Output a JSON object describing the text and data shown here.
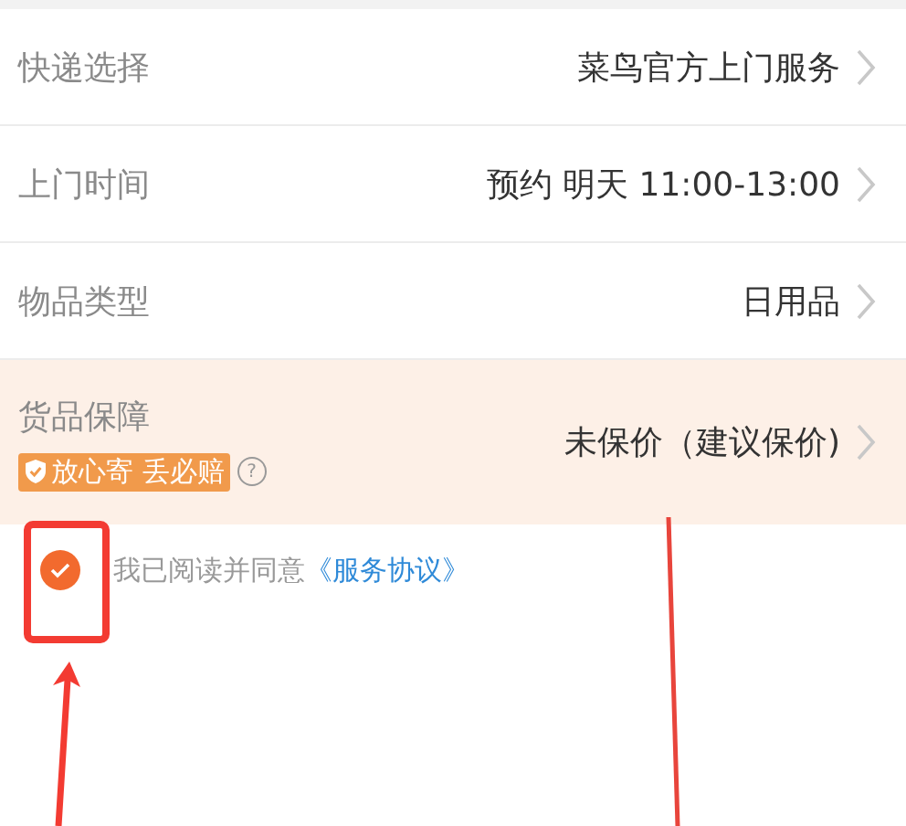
{
  "rows": [
    {
      "kind": "plain",
      "label": "快递选择",
      "value": "菜鸟官方上门服务"
    },
    {
      "kind": "plain",
      "label": "上门时间",
      "value": "预约 明天 11:00-13:00"
    },
    {
      "kind": "plain",
      "label": "物品类型",
      "value": "日用品"
    },
    {
      "kind": "protection",
      "label": "货品保障",
      "badge": "放心寄 丢必赔",
      "help": "?",
      "value": "未保价（建议保价)"
    }
  ],
  "agreement": {
    "checked": true,
    "text": "我已阅读并同意",
    "link": "《服务协议》"
  }
}
